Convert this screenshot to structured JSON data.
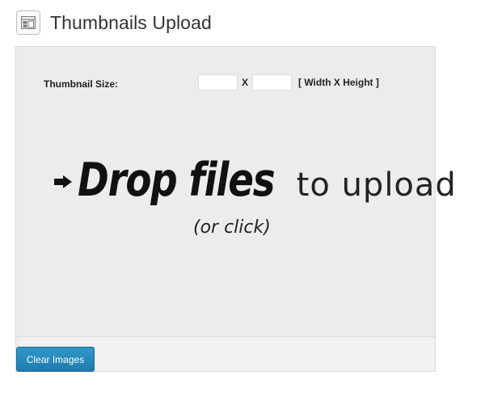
{
  "header": {
    "title": "Thumbnails Upload",
    "icon": "layout-icon"
  },
  "thumbnail_size": {
    "label": "Thumbnail Size:",
    "width_value": "",
    "height_value": "",
    "separator": "X",
    "hint": "[ Width X Height ]"
  },
  "dropzone": {
    "icon": "right-arrow-icon",
    "strong_text": "Drop files",
    "light_text": "to upload",
    "sub_text": "(or click)"
  },
  "actions": {
    "clear_label": "Clear Images"
  },
  "colors": {
    "button_blue": "#2a8bbf",
    "panel_bg": "#ececec"
  }
}
